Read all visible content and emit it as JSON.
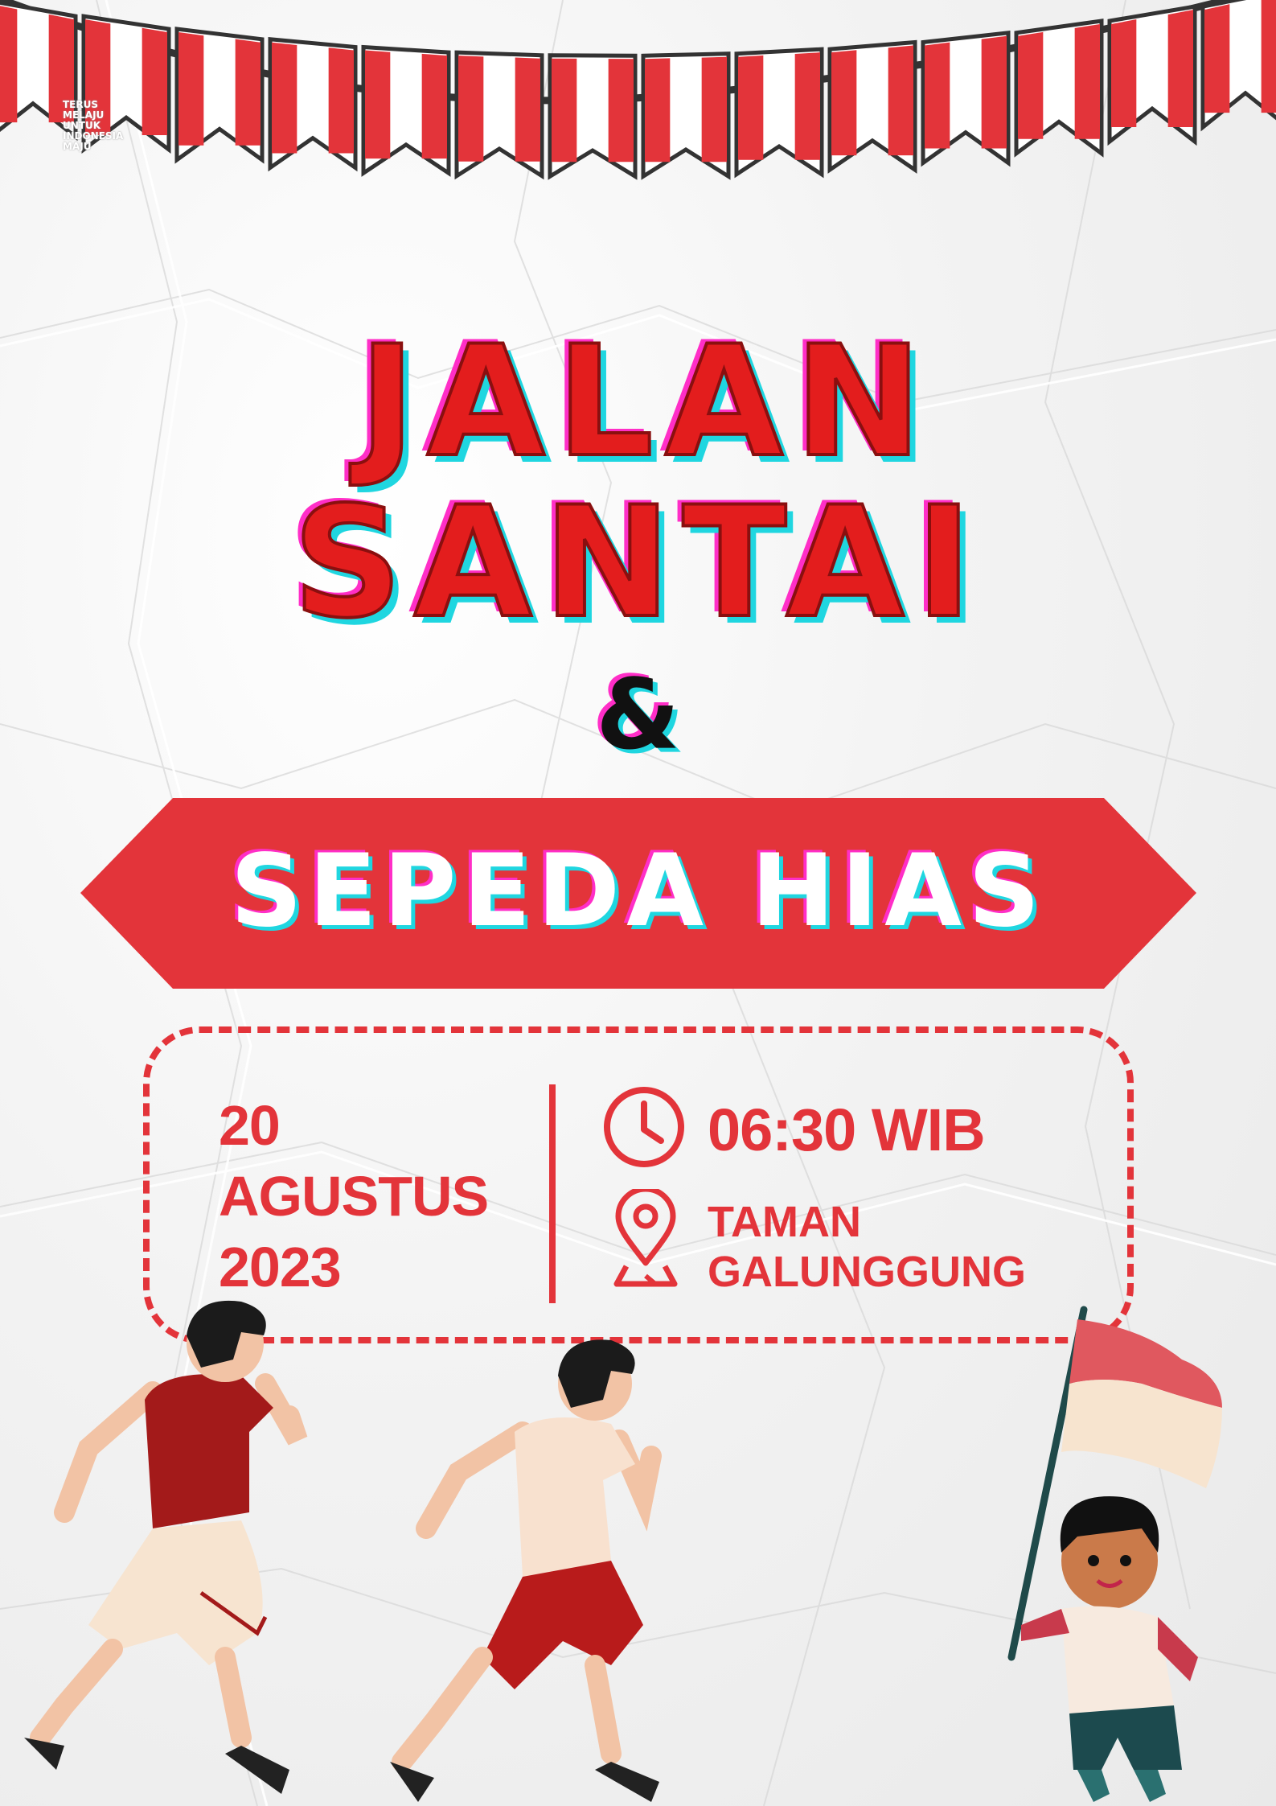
{
  "tagline": "TERUS MELAJU UNTUK INDONESIA MAJU",
  "title": {
    "line1": "JALAN",
    "line2": "SANTAI",
    "ampersand": "&",
    "subtitle": "SEPEDA HIAS"
  },
  "event": {
    "date_day": "20",
    "date_month": "AGUSTUS",
    "date_year": "2023",
    "time": "06:30 WIB",
    "place_line1": "TAMAN",
    "place_line2": "GALUNGGUNG"
  },
  "colors": {
    "red": "#e3343a",
    "title_red": "#e31d1d",
    "cyan_shadow": "#1fd6e0",
    "magenta_shadow": "#ff2ec7"
  },
  "icons": [
    "clock-icon",
    "map-pin-icon"
  ]
}
